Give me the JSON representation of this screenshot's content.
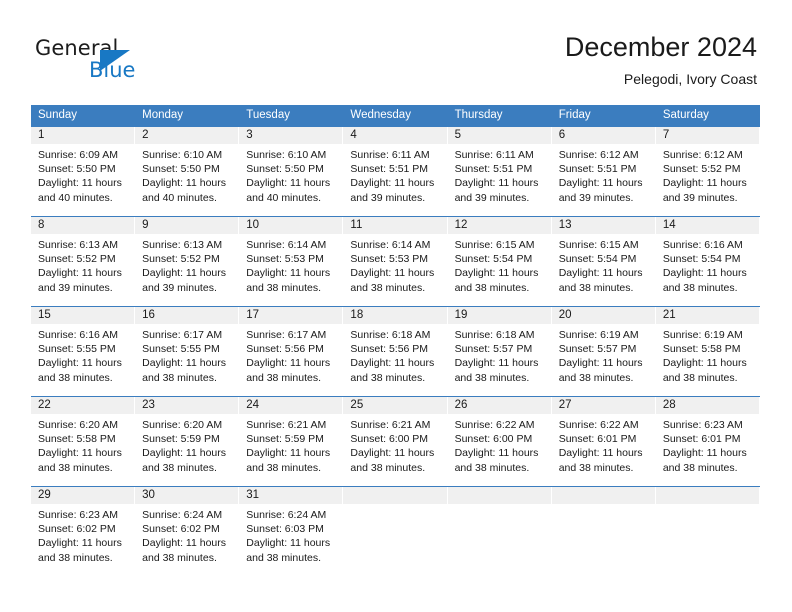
{
  "brand": {
    "logo_primary": "General",
    "logo_secondary": "Blue",
    "logo_icon": "triangle-icon",
    "accent_color": "#1878c4"
  },
  "header": {
    "title": "December 2024",
    "subtitle": "Pelegodi, Ivory Coast"
  },
  "calendar": {
    "header_bg": "#3b7dbf",
    "day_strip_bg": "#f0f0f0",
    "weekdays": [
      "Sunday",
      "Monday",
      "Tuesday",
      "Wednesday",
      "Thursday",
      "Friday",
      "Saturday"
    ],
    "weeks": [
      [
        {
          "day": "1",
          "sunrise": "Sunrise: 6:09 AM",
          "sunset": "Sunset: 5:50 PM",
          "daylight1": "Daylight: 11 hours",
          "daylight2": "and 40 minutes."
        },
        {
          "day": "2",
          "sunrise": "Sunrise: 6:10 AM",
          "sunset": "Sunset: 5:50 PM",
          "daylight1": "Daylight: 11 hours",
          "daylight2": "and 40 minutes."
        },
        {
          "day": "3",
          "sunrise": "Sunrise: 6:10 AM",
          "sunset": "Sunset: 5:50 PM",
          "daylight1": "Daylight: 11 hours",
          "daylight2": "and 40 minutes."
        },
        {
          "day": "4",
          "sunrise": "Sunrise: 6:11 AM",
          "sunset": "Sunset: 5:51 PM",
          "daylight1": "Daylight: 11 hours",
          "daylight2": "and 39 minutes."
        },
        {
          "day": "5",
          "sunrise": "Sunrise: 6:11 AM",
          "sunset": "Sunset: 5:51 PM",
          "daylight1": "Daylight: 11 hours",
          "daylight2": "and 39 minutes."
        },
        {
          "day": "6",
          "sunrise": "Sunrise: 6:12 AM",
          "sunset": "Sunset: 5:51 PM",
          "daylight1": "Daylight: 11 hours",
          "daylight2": "and 39 minutes."
        },
        {
          "day": "7",
          "sunrise": "Sunrise: 6:12 AM",
          "sunset": "Sunset: 5:52 PM",
          "daylight1": "Daylight: 11 hours",
          "daylight2": "and 39 minutes."
        }
      ],
      [
        {
          "day": "8",
          "sunrise": "Sunrise: 6:13 AM",
          "sunset": "Sunset: 5:52 PM",
          "daylight1": "Daylight: 11 hours",
          "daylight2": "and 39 minutes."
        },
        {
          "day": "9",
          "sunrise": "Sunrise: 6:13 AM",
          "sunset": "Sunset: 5:52 PM",
          "daylight1": "Daylight: 11 hours",
          "daylight2": "and 39 minutes."
        },
        {
          "day": "10",
          "sunrise": "Sunrise: 6:14 AM",
          "sunset": "Sunset: 5:53 PM",
          "daylight1": "Daylight: 11 hours",
          "daylight2": "and 38 minutes."
        },
        {
          "day": "11",
          "sunrise": "Sunrise: 6:14 AM",
          "sunset": "Sunset: 5:53 PM",
          "daylight1": "Daylight: 11 hours",
          "daylight2": "and 38 minutes."
        },
        {
          "day": "12",
          "sunrise": "Sunrise: 6:15 AM",
          "sunset": "Sunset: 5:54 PM",
          "daylight1": "Daylight: 11 hours",
          "daylight2": "and 38 minutes."
        },
        {
          "day": "13",
          "sunrise": "Sunrise: 6:15 AM",
          "sunset": "Sunset: 5:54 PM",
          "daylight1": "Daylight: 11 hours",
          "daylight2": "and 38 minutes."
        },
        {
          "day": "14",
          "sunrise": "Sunrise: 6:16 AM",
          "sunset": "Sunset: 5:54 PM",
          "daylight1": "Daylight: 11 hours",
          "daylight2": "and 38 minutes."
        }
      ],
      [
        {
          "day": "15",
          "sunrise": "Sunrise: 6:16 AM",
          "sunset": "Sunset: 5:55 PM",
          "daylight1": "Daylight: 11 hours",
          "daylight2": "and 38 minutes."
        },
        {
          "day": "16",
          "sunrise": "Sunrise: 6:17 AM",
          "sunset": "Sunset: 5:55 PM",
          "daylight1": "Daylight: 11 hours",
          "daylight2": "and 38 minutes."
        },
        {
          "day": "17",
          "sunrise": "Sunrise: 6:17 AM",
          "sunset": "Sunset: 5:56 PM",
          "daylight1": "Daylight: 11 hours",
          "daylight2": "and 38 minutes."
        },
        {
          "day": "18",
          "sunrise": "Sunrise: 6:18 AM",
          "sunset": "Sunset: 5:56 PM",
          "daylight1": "Daylight: 11 hours",
          "daylight2": "and 38 minutes."
        },
        {
          "day": "19",
          "sunrise": "Sunrise: 6:18 AM",
          "sunset": "Sunset: 5:57 PM",
          "daylight1": "Daylight: 11 hours",
          "daylight2": "and 38 minutes."
        },
        {
          "day": "20",
          "sunrise": "Sunrise: 6:19 AM",
          "sunset": "Sunset: 5:57 PM",
          "daylight1": "Daylight: 11 hours",
          "daylight2": "and 38 minutes."
        },
        {
          "day": "21",
          "sunrise": "Sunrise: 6:19 AM",
          "sunset": "Sunset: 5:58 PM",
          "daylight1": "Daylight: 11 hours",
          "daylight2": "and 38 minutes."
        }
      ],
      [
        {
          "day": "22",
          "sunrise": "Sunrise: 6:20 AM",
          "sunset": "Sunset: 5:58 PM",
          "daylight1": "Daylight: 11 hours",
          "daylight2": "and 38 minutes."
        },
        {
          "day": "23",
          "sunrise": "Sunrise: 6:20 AM",
          "sunset": "Sunset: 5:59 PM",
          "daylight1": "Daylight: 11 hours",
          "daylight2": "and 38 minutes."
        },
        {
          "day": "24",
          "sunrise": "Sunrise: 6:21 AM",
          "sunset": "Sunset: 5:59 PM",
          "daylight1": "Daylight: 11 hours",
          "daylight2": "and 38 minutes."
        },
        {
          "day": "25",
          "sunrise": "Sunrise: 6:21 AM",
          "sunset": "Sunset: 6:00 PM",
          "daylight1": "Daylight: 11 hours",
          "daylight2": "and 38 minutes."
        },
        {
          "day": "26",
          "sunrise": "Sunrise: 6:22 AM",
          "sunset": "Sunset: 6:00 PM",
          "daylight1": "Daylight: 11 hours",
          "daylight2": "and 38 minutes."
        },
        {
          "day": "27",
          "sunrise": "Sunrise: 6:22 AM",
          "sunset": "Sunset: 6:01 PM",
          "daylight1": "Daylight: 11 hours",
          "daylight2": "and 38 minutes."
        },
        {
          "day": "28",
          "sunrise": "Sunrise: 6:23 AM",
          "sunset": "Sunset: 6:01 PM",
          "daylight1": "Daylight: 11 hours",
          "daylight2": "and 38 minutes."
        }
      ],
      [
        {
          "day": "29",
          "sunrise": "Sunrise: 6:23 AM",
          "sunset": "Sunset: 6:02 PM",
          "daylight1": "Daylight: 11 hours",
          "daylight2": "and 38 minutes."
        },
        {
          "day": "30",
          "sunrise": "Sunrise: 6:24 AM",
          "sunset": "Sunset: 6:02 PM",
          "daylight1": "Daylight: 11 hours",
          "daylight2": "and 38 minutes."
        },
        {
          "day": "31",
          "sunrise": "Sunrise: 6:24 AM",
          "sunset": "Sunset: 6:03 PM",
          "daylight1": "Daylight: 11 hours",
          "daylight2": "and 38 minutes."
        },
        {
          "day": "",
          "sunrise": "",
          "sunset": "",
          "daylight1": "",
          "daylight2": ""
        },
        {
          "day": "",
          "sunrise": "",
          "sunset": "",
          "daylight1": "",
          "daylight2": ""
        },
        {
          "day": "",
          "sunrise": "",
          "sunset": "",
          "daylight1": "",
          "daylight2": ""
        },
        {
          "day": "",
          "sunrise": "",
          "sunset": "",
          "daylight1": "",
          "daylight2": ""
        }
      ]
    ]
  }
}
